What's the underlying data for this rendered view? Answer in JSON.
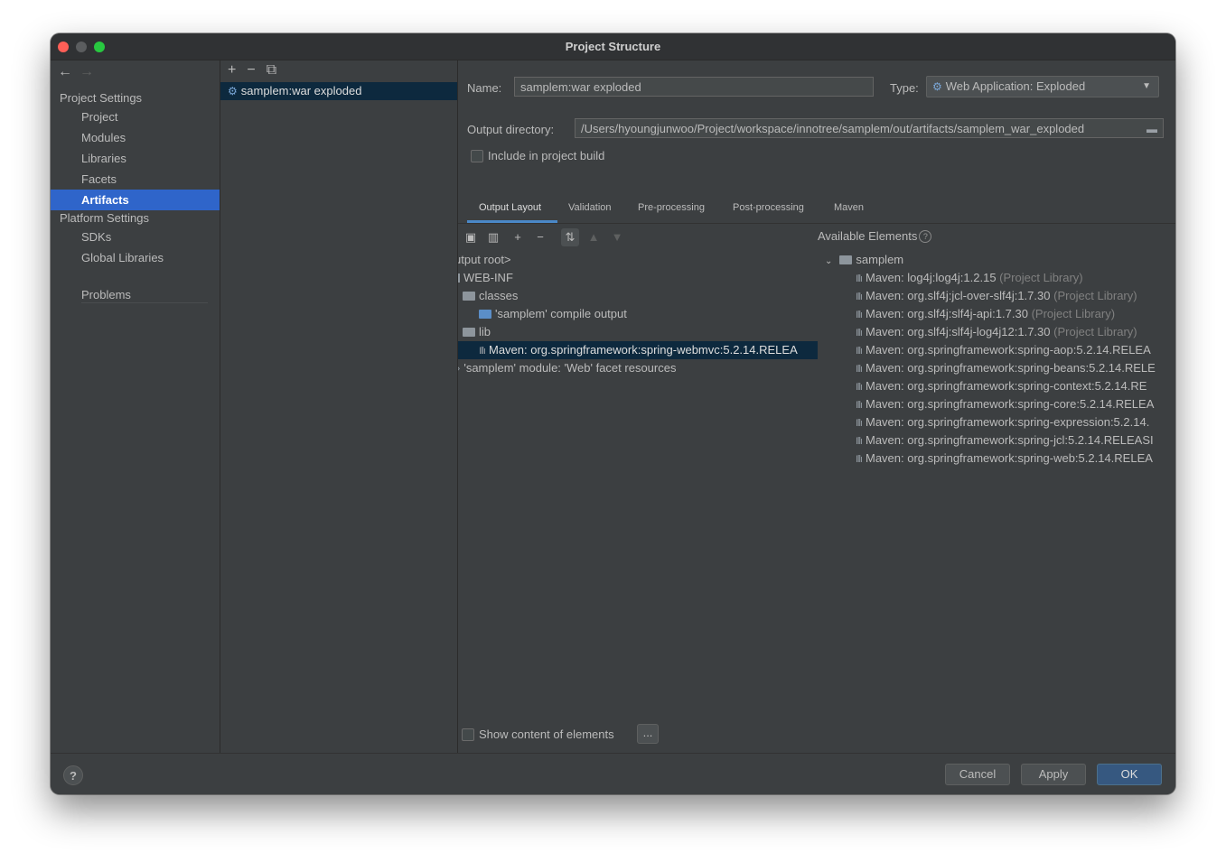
{
  "window": {
    "title": "Project Structure"
  },
  "nav": {
    "back": "←",
    "forward": "→",
    "project_settings": "Project Settings",
    "items_project": [
      "Project",
      "Modules",
      "Libraries",
      "Facets",
      "Artifacts"
    ],
    "platform_settings": "Platform Settings",
    "items_platform": [
      "SDKs",
      "Global Libraries"
    ],
    "problems": "Problems",
    "selected": "Artifacts"
  },
  "artifacts": {
    "toolbar": {
      "add": "+",
      "remove": "−",
      "copy": "⧉"
    },
    "list": [
      "samplem:war exploded"
    ]
  },
  "form": {
    "name_label": "Name:",
    "name_value": "samplem:war exploded",
    "type_label": "Type:",
    "type_value": "Web Application: Exploded",
    "output_label": "Output directory:",
    "output_value": "/Users/hyoungjunwoo/Project/workspace/innotree/samplem/out/artifacts/samplem_war_exploded",
    "include_label": "Include in project build"
  },
  "tabs": [
    "Output Layout",
    "Validation",
    "Pre-processing",
    "Post-processing",
    "Maven"
  ],
  "active_tab": "Output Layout",
  "layout_tree": [
    {
      "text": "utput root>"
    },
    {
      "text": "WEB-INF"
    },
    {
      "text": "classes"
    },
    {
      "text": "'samplem' compile output"
    },
    {
      "text": "lib"
    },
    {
      "text": "Maven: org.springframework:spring-webmvc:5.2.14.RELEA"
    },
    {
      "text": "'samplem' module: 'Web' facet resources"
    }
  ],
  "available": {
    "label": "Available Elements",
    "root": "samplem",
    "items": [
      {
        "name": "Maven: log4j:log4j:1.2.15",
        "tag": "(Project Library)"
      },
      {
        "name": "Maven: org.slf4j:jcl-over-slf4j:1.7.30",
        "tag": "(Project Library)"
      },
      {
        "name": "Maven: org.slf4j:slf4j-api:1.7.30",
        "tag": "(Project Library)"
      },
      {
        "name": "Maven: org.slf4j:slf4j-log4j12:1.7.30",
        "tag": "(Project Library)"
      },
      {
        "name": "Maven: org.springframework:spring-aop:5.2.14.RELEA",
        "tag": ""
      },
      {
        "name": "Maven: org.springframework:spring-beans:5.2.14.RELE",
        "tag": ""
      },
      {
        "name": "Maven: org.springframework:spring-context:5.2.14.RE",
        "tag": ""
      },
      {
        "name": "Maven: org.springframework:spring-core:5.2.14.RELEA",
        "tag": ""
      },
      {
        "name": "Maven: org.springframework:spring-expression:5.2.14.",
        "tag": ""
      },
      {
        "name": "Maven: org.springframework:spring-jcl:5.2.14.RELEASI",
        "tag": ""
      },
      {
        "name": "Maven: org.springframework:spring-web:5.2.14.RELEA",
        "tag": ""
      }
    ]
  },
  "bottom": {
    "show_content_label": "Show content of elements",
    "ellipsis": "..."
  },
  "footer": {
    "help": "?",
    "cancel": "Cancel",
    "apply": "Apply",
    "ok": "OK"
  },
  "colors": {
    "selection": "#2f65ca",
    "row_selection": "#0d293e",
    "primary_button": "#365880",
    "panel": "#3c3f41"
  }
}
